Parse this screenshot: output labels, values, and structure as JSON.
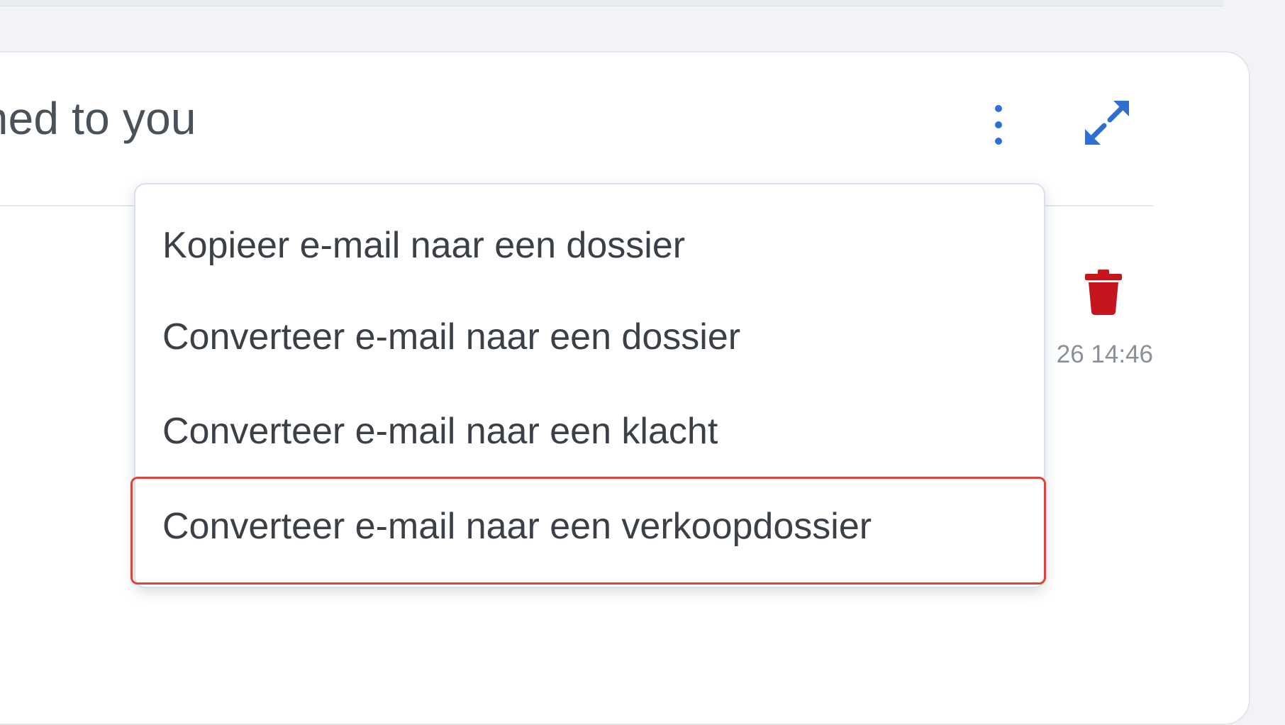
{
  "card": {
    "title": "gned to you"
  },
  "toolbar": {
    "more_icon": "vertical-dots-icon",
    "expand_icon": "expand-arrows-icon",
    "accent_color": "#2f6fd3"
  },
  "email_row": {
    "delete_icon": "trash-icon",
    "delete_color": "#c4161c",
    "timestamp": "26 14:46"
  },
  "menu": {
    "items": [
      {
        "label": "Kopieer e-mail naar een dossier"
      },
      {
        "label": "Converteer e-mail naar een dossier"
      },
      {
        "label": "Converteer e-mail naar een klacht"
      },
      {
        "label": "Converteer e-mail naar een verkoopdossier"
      }
    ],
    "highlighted_index": 3,
    "highlight_color": "#d9473b"
  }
}
